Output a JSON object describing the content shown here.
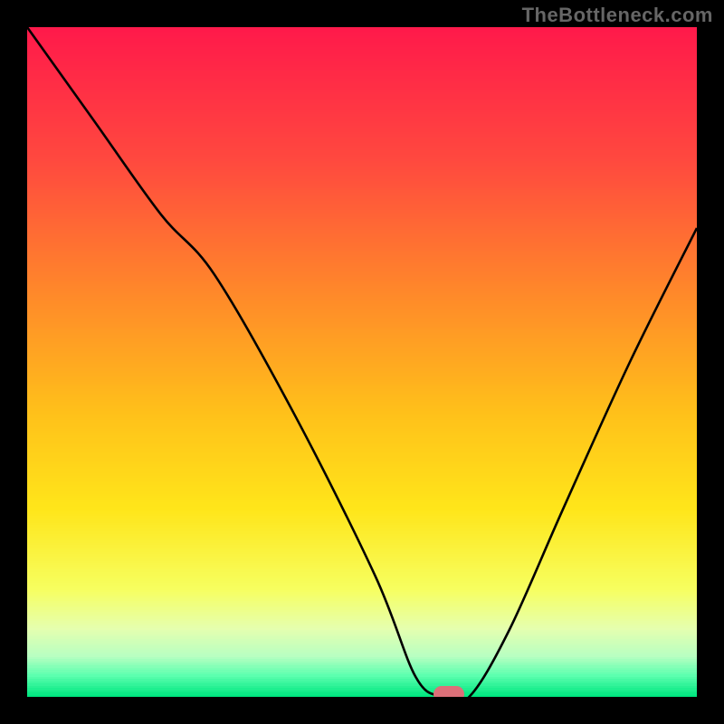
{
  "watermark": "TheBottleneck.com",
  "chart_data": {
    "type": "line",
    "title": "",
    "xlabel": "",
    "ylabel": "",
    "xlim": [
      0,
      100
    ],
    "ylim": [
      0,
      100
    ],
    "x": [
      0,
      10,
      20,
      28,
      40,
      52,
      58,
      62,
      66,
      72,
      80,
      90,
      100
    ],
    "values": [
      100,
      86,
      72,
      63,
      42,
      18,
      3,
      0,
      0,
      10,
      28,
      50,
      70
    ],
    "heatmap_gradient": [
      {
        "pos": 0.0,
        "color": "#ff1a4b"
      },
      {
        "pos": 0.2,
        "color": "#ff4a3f"
      },
      {
        "pos": 0.4,
        "color": "#ff8a2a"
      },
      {
        "pos": 0.58,
        "color": "#ffc21a"
      },
      {
        "pos": 0.72,
        "color": "#ffe61a"
      },
      {
        "pos": 0.84,
        "color": "#f7ff60"
      },
      {
        "pos": 0.9,
        "color": "#e5ffb0"
      },
      {
        "pos": 0.94,
        "color": "#b9ffc2"
      },
      {
        "pos": 0.97,
        "color": "#5cffaf"
      },
      {
        "pos": 1.0,
        "color": "#00e780"
      }
    ],
    "marker": {
      "x": 63,
      "y": 0,
      "color": "#dc7079"
    },
    "line_color": "#000000"
  },
  "frame_color": "#000000"
}
